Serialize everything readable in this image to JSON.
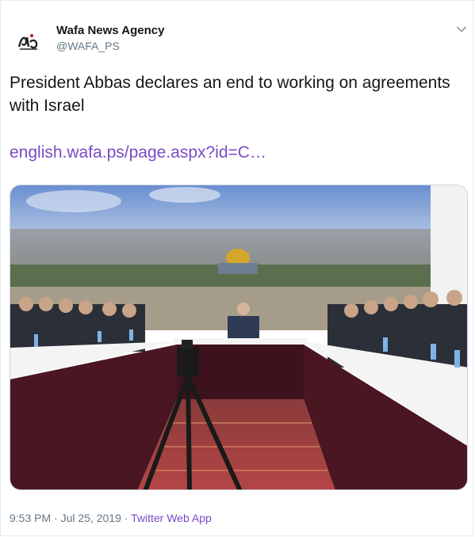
{
  "author": {
    "name": "Wafa News Agency",
    "handle": "@WAFA_PS",
    "avatar_logo": "wafa-logo"
  },
  "tweet": {
    "text": "President Abbas declares an end to working on agreements with Israel",
    "link": "english.wafa.ps/page.aspx?id=C…"
  },
  "media": {
    "description_icon": "photo"
  },
  "meta": {
    "time": "9:53 PM",
    "separator1": " · ",
    "date": "Jul 25, 2019",
    "separator2": " · ",
    "source": "Twitter Web App"
  },
  "colors": {
    "link": "#794bc4",
    "secondary": "#657786",
    "text": "#14171a"
  }
}
